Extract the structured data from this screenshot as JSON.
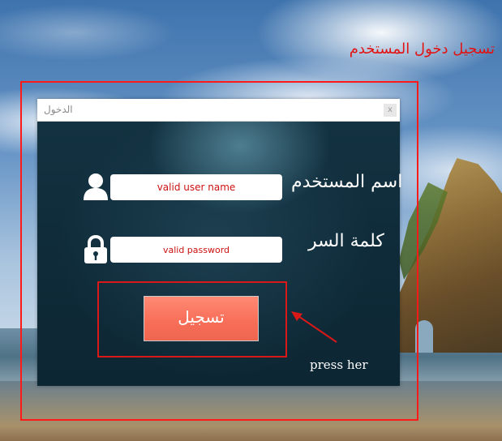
{
  "annotation": {
    "title": "تسجيل دخول المستخدم",
    "hint": "press her"
  },
  "window": {
    "title": "الدخول",
    "close_symbol": "x"
  },
  "form": {
    "username_label": "اسم المستخدم",
    "username_value": "valid user name",
    "password_label": "كلمة السر",
    "password_value": "valid password",
    "submit_label": "تسجيل"
  },
  "icons": {
    "user": "user-icon",
    "lock": "lock-icon",
    "arrow": "arrow-icon"
  },
  "colors": {
    "annotation": "#e11414",
    "button": "#f86f59",
    "panel": "#133241",
    "field_text": "#cc1111"
  }
}
